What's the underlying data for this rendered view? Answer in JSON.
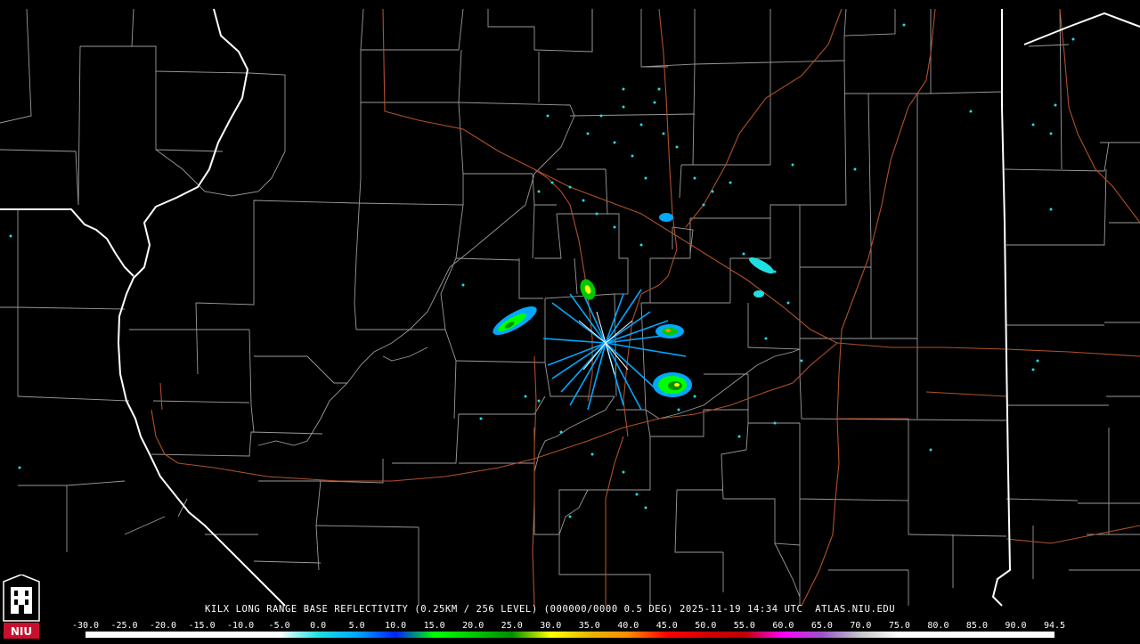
{
  "radar": {
    "caption": "KILX LONG RANGE BASE REFLECTIVITY (0.25KM / 256 LEVEL) (000000/0000 0.5 DEG) 2025-11-19 14:34 UTC  ATLAS.NIU.EDU",
    "logo_text": "NIU",
    "scale_ticks": [
      "-30.0",
      "-25.0",
      "-20.0",
      "-15.0",
      "-10.0",
      "-5.0",
      "0.0",
      "5.0",
      "10.0",
      "15.0",
      "20.0",
      "25.0",
      "30.0",
      "35.0",
      "40.0",
      "45.0",
      "50.0",
      "55.0",
      "60.0",
      "65.0",
      "70.0",
      "75.0",
      "80.0",
      "85.0",
      "90.0",
      "94.5"
    ],
    "scale_colors": [
      "#ffffff",
      "#ffffff",
      "#ffffff",
      "#ffffff",
      "#ffffff",
      "#ffffff",
      "#1fe0e0",
      "#00a8ff",
      "#0020ff",
      "#00ff00",
      "#00c800",
      "#009000",
      "#ffff00",
      "#e6b800",
      "#ff8c00",
      "#ff0000",
      "#d40000",
      "#bc0000",
      "#ff00ff",
      "#9955c9",
      "#c8c8c8",
      "#ffffff",
      "#ffffff",
      "#ffffff",
      "#ffffff",
      "#ffffff"
    ],
    "accent_colors": {
      "background": "#000000",
      "county_lines": "#9a9a9a",
      "state_lines": "#ffffff",
      "highways": "#b0502a"
    }
  }
}
